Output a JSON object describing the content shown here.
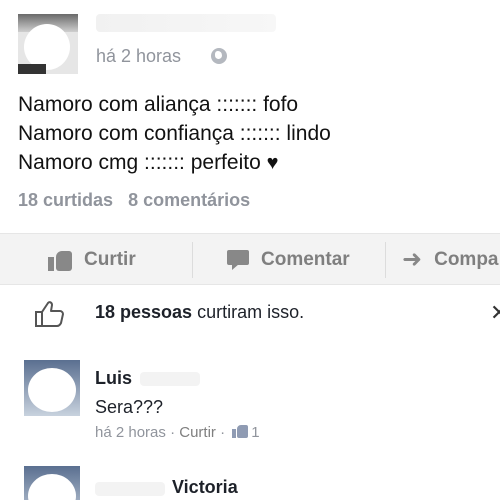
{
  "post": {
    "time": "há 2 horas",
    "lines": [
      "Namoro com aliança ::::::: fofo",
      "Namoro com confiança ::::::: lindo",
      "Namoro cmg ::::::: perfeito"
    ],
    "heart": "♥",
    "likes_count": "18 curtidas",
    "comments_count": "8 comentários"
  },
  "actions": {
    "like": "Curtir",
    "comment": "Comentar",
    "share": "Compa"
  },
  "likers": {
    "count_bold": "18 pessoas",
    "suffix": " curtiram isso."
  },
  "comments": [
    {
      "name": "Luis",
      "text": "Sera???",
      "time": "há 2 horas",
      "like_label": "Curtir",
      "likes": "1"
    },
    {
      "name": "Victoria"
    }
  ],
  "icons": {
    "globe": "globe-icon",
    "like": "thumbs-up-icon",
    "comment": "comment-icon",
    "share": "share-arrow-icon",
    "close": "close-icon"
  },
  "colors": {
    "meta_gray": "#90949c",
    "action_bar_bg": "#f3f3f3",
    "action_text": "#7f7f7f"
  }
}
